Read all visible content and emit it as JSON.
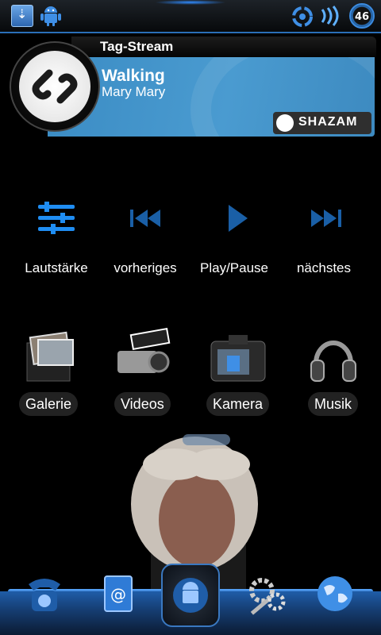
{
  "status_bar": {
    "battery_level": "46",
    "icons": [
      "usb-debug-icon",
      "android-notify-icon",
      "sync-icon",
      "wifi-icon",
      "battery-icon"
    ]
  },
  "shazam_widget": {
    "header": "Tag-Stream",
    "song_title": "Walking",
    "artist": "Mary Mary",
    "brand": "SHAZAM"
  },
  "media_controls": [
    {
      "label": "Lautstärke",
      "icon": "volume-sliders-icon"
    },
    {
      "label": "vorheriges",
      "icon": "previous-track-icon"
    },
    {
      "label": "Play/Pause",
      "icon": "play-icon"
    },
    {
      "label": "nächstes",
      "icon": "next-track-icon"
    }
  ],
  "apps": [
    {
      "label": "Galerie",
      "icon": "gallery-icon"
    },
    {
      "label": "Videos",
      "icon": "video-camera-icon"
    },
    {
      "label": "Kamera",
      "icon": "camera-icon"
    },
    {
      "label": "Musik",
      "icon": "headphones-icon"
    }
  ],
  "dock": [
    "phone-icon",
    "contacts-icon",
    "app-drawer-icon",
    "settings-gears-icon",
    "browser-globe-icon"
  ],
  "colors": {
    "accent": "#2a6fb8",
    "widget_blue": "#4a9bd0",
    "control_blue": "#1f8df2"
  }
}
